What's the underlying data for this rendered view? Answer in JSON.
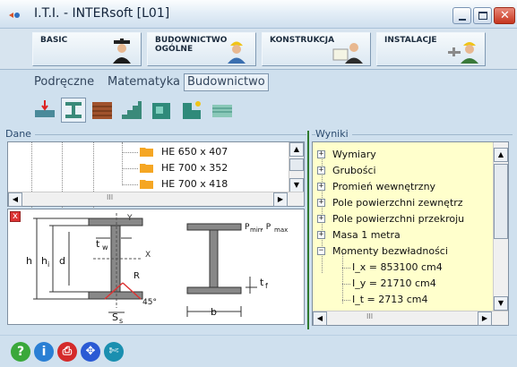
{
  "window": {
    "title": "I.T.I. - INTERsoft [L01]",
    "close_glyph": "✕"
  },
  "modules": [
    {
      "label": "BASIC",
      "icon": "graduate-icon"
    },
    {
      "label": "BUDOWNICTWO\nOGÓLNE",
      "icon": "builder-icon"
    },
    {
      "label": "KONSTRUKCJA",
      "icon": "engineer-blueprint-icon"
    },
    {
      "label": "INSTALACJE",
      "icon": "plumber-icon"
    }
  ],
  "category_tabs": [
    {
      "label": "Podręczne",
      "active": false
    },
    {
      "label": "Matematyka",
      "active": false
    },
    {
      "label": "Budownictwo",
      "active": true
    }
  ],
  "tools": [
    "beam-load-icon",
    "i-beam-profile-icon",
    "bricks-icon",
    "stairs-icon",
    "wall-icon",
    "corner-icon",
    "insulation-icon"
  ],
  "dane": {
    "label": "Dane",
    "items": [
      "HE 650 x 407",
      "HE 700 x 352",
      "HE 700 x 418"
    ],
    "hscroll_grip": "III"
  },
  "drawing": {
    "close_glyph": "x",
    "labels": {
      "y": "Y",
      "x": "X",
      "h": "h",
      "hi": "h",
      "hi_sub": "i",
      "d": "d",
      "tw": "t",
      "tw_sub": "w",
      "r": "R",
      "angle": "45°",
      "ss": "S",
      "ss_sub": "s",
      "b": "b",
      "tf": "t",
      "tf_sub": "f",
      "pmin": "P",
      "pmin_sub": "min",
      "pmax": ", P",
      "pmax_sub": "max"
    }
  },
  "wyniki": {
    "label": "Wyniki",
    "items": [
      {
        "label": "Wymiary",
        "expanded": false
      },
      {
        "label": "Grubości",
        "expanded": false
      },
      {
        "label": "Promień wewnętrzny",
        "expanded": false
      },
      {
        "label": "Pole powierzchni zewnętrz",
        "expanded": false
      },
      {
        "label": "Pole powierzchni przekroju",
        "expanded": false
      },
      {
        "label": "Masa 1 metra",
        "expanded": false
      },
      {
        "label": "Momenty bezwładności",
        "expanded": true
      },
      {
        "label": "I_x = 853100 cm4",
        "leaf": true
      },
      {
        "label": "I_y = 21710 cm4",
        "leaf": true
      },
      {
        "label": "I_t = 2713 cm4",
        "leaf": true
      }
    ],
    "hscroll_grip": "III",
    "expand_glyph": "+",
    "collapse_glyph": "−"
  },
  "bottom_icons": [
    {
      "name": "help-icon",
      "glyph": "?",
      "color": "#3aa83a"
    },
    {
      "name": "info-icon",
      "glyph": "i",
      "color": "#2a7fd4"
    },
    {
      "name": "print-icon",
      "glyph": "⎙",
      "color": "#d42a2a"
    },
    {
      "name": "move-icon",
      "glyph": "✥",
      "color": "#2a5ad4"
    },
    {
      "name": "tools-icon",
      "glyph": "✄",
      "color": "#1a8fb0"
    }
  ],
  "scroll_glyphs": {
    "up": "▲",
    "down": "▼",
    "left": "◀",
    "right": "▶"
  }
}
